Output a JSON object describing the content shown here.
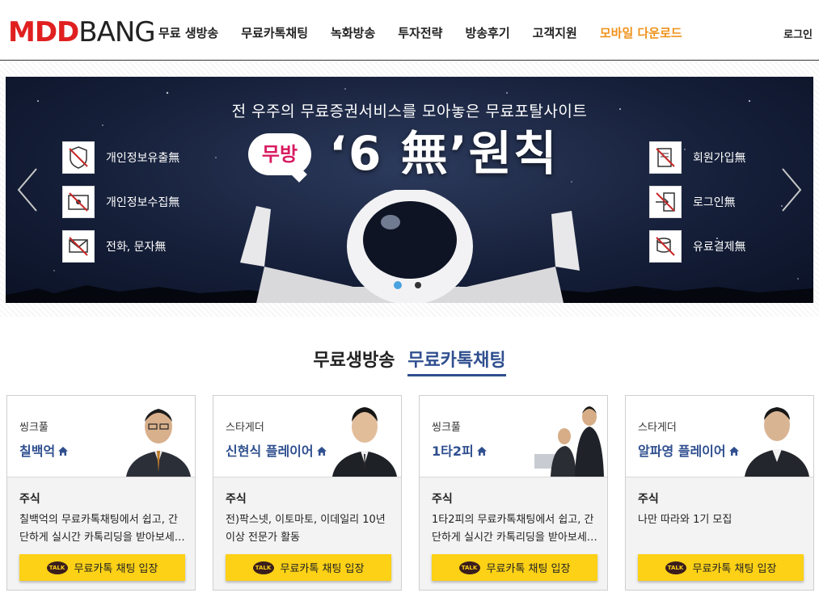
{
  "header": {
    "logo_m": "MDD",
    "logo_b": "BANG",
    "nav": [
      "무료 생방송",
      "무료카톡채팅",
      "녹화방송",
      "투자전략",
      "방송후기",
      "고객지원",
      "모바일 다운로드"
    ],
    "login": "로그인",
    "highlight_color": "#f0931c"
  },
  "banner": {
    "subtitle": "전 우주의 무료증권서비스를 모아놓은 무료포탈사이트",
    "bubble": "무방",
    "headline": "‘6 無’원칙",
    "left_features": [
      "개인정보유출無",
      "개인정보수집無",
      "전화, 문자無"
    ],
    "right_features": [
      "회원가입無",
      "로그인無",
      "유료결제無"
    ]
  },
  "section": {
    "title1": "무료생방송",
    "title2": "무료카톡채팅"
  },
  "cards": [
    {
      "category": "씽크풀",
      "name": "칠백억",
      "kind": "주식",
      "desc": "칠백억의 무료카톡채팅에서 쉽고, 간단하게 실시간 카톡리딩을 받아보세…",
      "button": "무료카톡 채팅 입장"
    },
    {
      "category": "스타게더",
      "name": "신현식 플레이어",
      "kind": "주식",
      "desc": "전)팍스넷, 이토마토, 이데일리 10년이상 전문가 활동",
      "button": "무료카톡 채팅 입장"
    },
    {
      "category": "씽크풀",
      "name": "1타2피",
      "kind": "주식",
      "desc": "1타2피의 무료카톡채팅에서 쉽고, 간단하게 실시간 카톡리딩을 받아보세…",
      "button": "무료카톡 채팅 입장"
    },
    {
      "category": "스타게더",
      "name": "알파영 플레이어",
      "kind": "주식",
      "desc": "나만 따라와 1기 모집",
      "button": "무료카톡 채팅 입장"
    }
  ],
  "talk_badge": "TALK"
}
